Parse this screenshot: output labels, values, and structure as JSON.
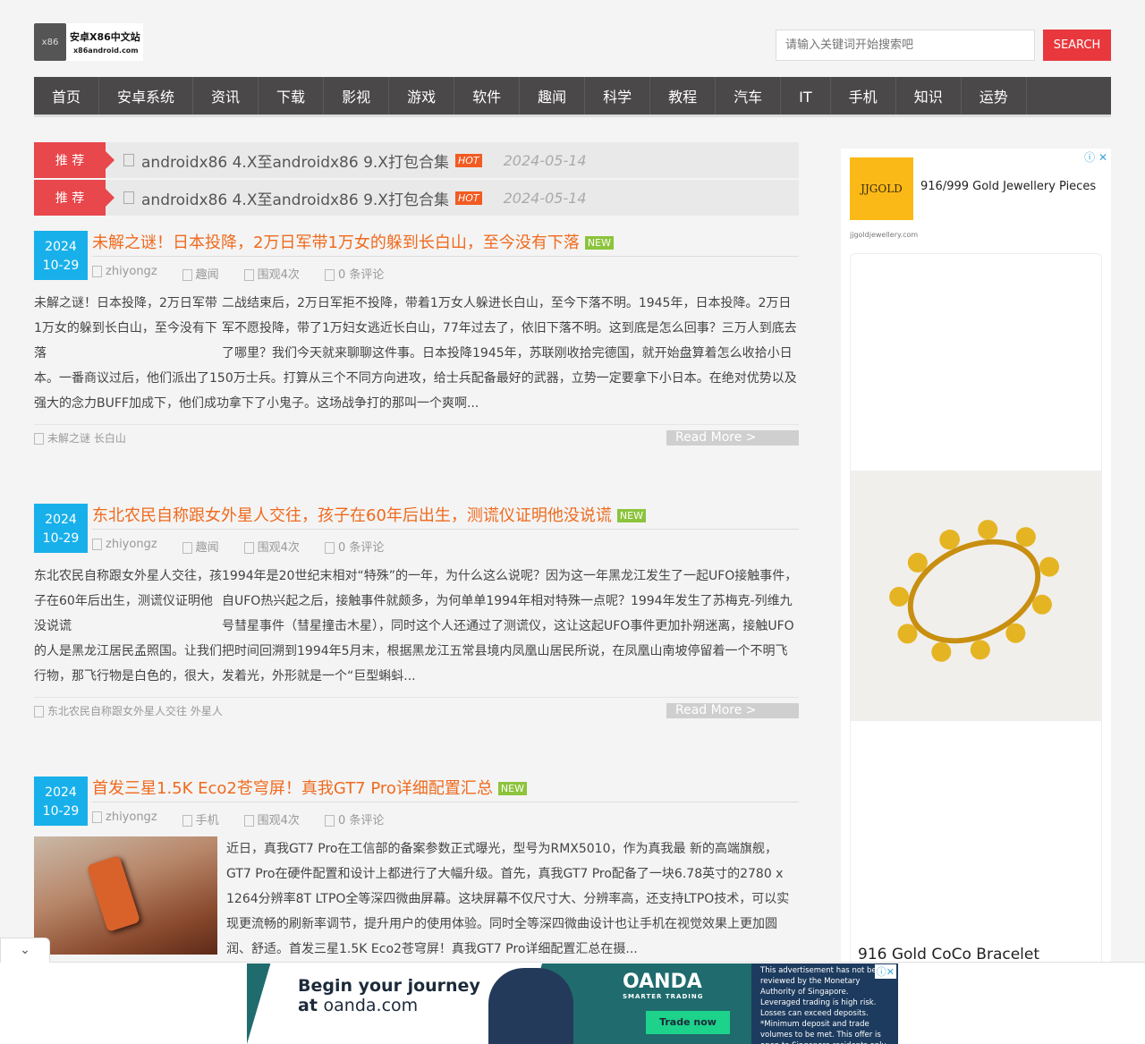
{
  "header": {
    "logo_name": "安卓X86中文站",
    "logo_url": "x86android.com",
    "logo_badge": "x86",
    "search_placeholder": "请输入关键词开始搜索吧",
    "search_button": "SEARCH"
  },
  "nav": [
    "首页",
    "安卓系统",
    "资讯",
    "下载",
    "影视",
    "游戏",
    "软件",
    "趣闻",
    "科学",
    "教程",
    "汽车",
    "IT",
    "手机",
    "知识",
    "运势"
  ],
  "recommended": [
    {
      "tag": "推 荐",
      "title": "androidx86 4.X至androidx86 9.X打包合集",
      "badge": "HOT",
      "date": "2024-05-14"
    },
    {
      "tag": "推 荐",
      "title": "androidx86 4.X至androidx86 9.X打包合集",
      "badge": "HOT",
      "date": "2024-05-14"
    }
  ],
  "articles": [
    {
      "year": "2024",
      "md": "10-29",
      "title": "未解之谜！日本投降，2万日军带1万女的躲到长白山，至今没有下落",
      "badge": "NEW",
      "author": "zhiyongz",
      "category": "趣闻",
      "views": "围观4次",
      "comments": "0 条评论",
      "image_alt": "未解之谜！日本投降，2万日军带1万女的躲到长白山，至今没有下落",
      "excerpt": "二战结束后，2万日军拒不投降，带着1万女人躲进长白山，至今下落不明。1945年，日本投降。2万日军不愿投降，带了1万妇女逃近长白山，77年过去了，依旧下落不明。这到底是怎么回事？三万人到底去了哪里？我们今天就来聊聊这件事。日本投降1945年，苏联刚收拾完德国，就开始盘算着怎么收拾小日本。一番商议过后，他们派出了150万士兵。打算从三个不同方向进攻，给士兵配备最好的武器，立势一定要拿下小日本。在绝对优势以及强大的念力BUFF加成下，他们成功拿下了小鬼子。这场战争打的那叫一个爽啊...",
      "tags": "未解之谜 长白山",
      "read_more": "Read More >"
    },
    {
      "year": "2024",
      "md": "10-29",
      "title": "东北农民自称跟女外星人交往，孩子在60年后出生，测谎仪证明他没说谎",
      "badge": "NEW",
      "author": "zhiyongz",
      "category": "趣闻",
      "views": "围观4次",
      "comments": "0 条评论",
      "image_alt": "东北农民自称跟女外星人交往，孩子在60年后出生，测谎仪证明他没说谎",
      "excerpt": "1994年是20世纪末相对“特殊”的一年，为什么这么说呢？因为这一年黑龙江发生了一起UFO接触事件，自UFO热兴起之后，接触事件就颇多，为何单单1994年相对特殊一点呢？1994年发生了苏梅克-列维九号彗星事件（彗星撞击木星），同时这个人还通过了测谎仪，这让这起UFO事件更加扑朔迷离，接触UFO的人是黑龙江居民孟照国。让我们把时间回溯到1994年5月末，根据黑龙江五常县境内凤凰山居民所说，在凤凰山南坡停留着一个不明飞行物，那飞行物是白色的，很大，发着光，外形就是一个“巨型蝌蚪...",
      "tags": "东北农民自称跟女外星人交往 外星人",
      "read_more": "Read More >"
    },
    {
      "year": "2024",
      "md": "10-29",
      "title": "首发三星1.5K Eco2苍穹屏！真我GT7 Pro详细配置汇总",
      "badge": "NEW",
      "author": "zhiyongz",
      "category": "手机",
      "views": "围观4次",
      "comments": "0 条评论",
      "excerpt": "近日，真我GT7 Pro在工信部的备案参数正式曝光，型号为RMX5010，作为真我最 新的高端旗舰，GT7 Pro在硬件配置和设计上都进行了大幅升级。首先，真我GT7 Pro配备了一块6.78英寸的2780 x 1264分辨率8T LTPO全等深四微曲屏幕。这块屏幕不仅尺寸大、分辨率高，还支持LTPO技术，可以实现更流畅的刷新率调节，提升用户的使用体验。同时全等深四微曲设计也让手机在视觉效果上更加圆润、舒适。首发三星1.5K Eco2苍穹屏！真我GT7 Pro详细配置汇总在摄..."
    }
  ],
  "sidebar_ad": {
    "brand": "JJGOLD",
    "headline": "916/999 Gold Jewellery Pieces",
    "domain": "jjgoldjewellery.com",
    "product": "916 Gold CoCo Bracelet"
  },
  "bottom_ad": {
    "line1": "Begin your journey",
    "line2_bold": "at",
    "line2": "oanda.com",
    "brand": "OANDA",
    "tagline": "SMARTER TRADING",
    "cta": "Trade now",
    "disclaimer": "This advertisement has not been reviewed by the Monetary Authority of Singapore. Leveraged trading is high risk. Losses can exceed deposits. *Minimum deposit and trade volumes to be met. This offer is open to Singapore residents only."
  }
}
